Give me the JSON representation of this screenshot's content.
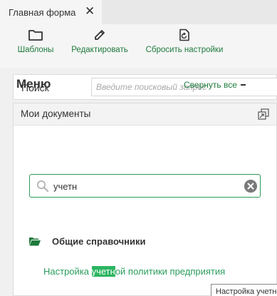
{
  "tab": {
    "label": "Главная форма",
    "close_icon": "close-icon"
  },
  "toolbar": {
    "templates_label": "Шаблоны",
    "edit_label": "Редактировать",
    "reset_label": "Сбросить настройки"
  },
  "search": {
    "label": "Поиск",
    "placeholder": "Введите поисковый запрос",
    "value": ""
  },
  "panel": {
    "title": "Мои документы"
  },
  "menu": {
    "title": "Меню",
    "collapse_all": "Свернуть все",
    "search_value": "учетн",
    "section": {
      "label": "Общие справочники"
    },
    "item": {
      "prefix": "Настройка ",
      "match": "учетн",
      "suffix": "ой политики предприятия"
    },
    "tooltip": "Настройка учетной политики предприятия"
  },
  "colors": {
    "accent_green": "#1e7a3c",
    "link_green": "#2a9d5e",
    "highlight": "#2bb560"
  }
}
